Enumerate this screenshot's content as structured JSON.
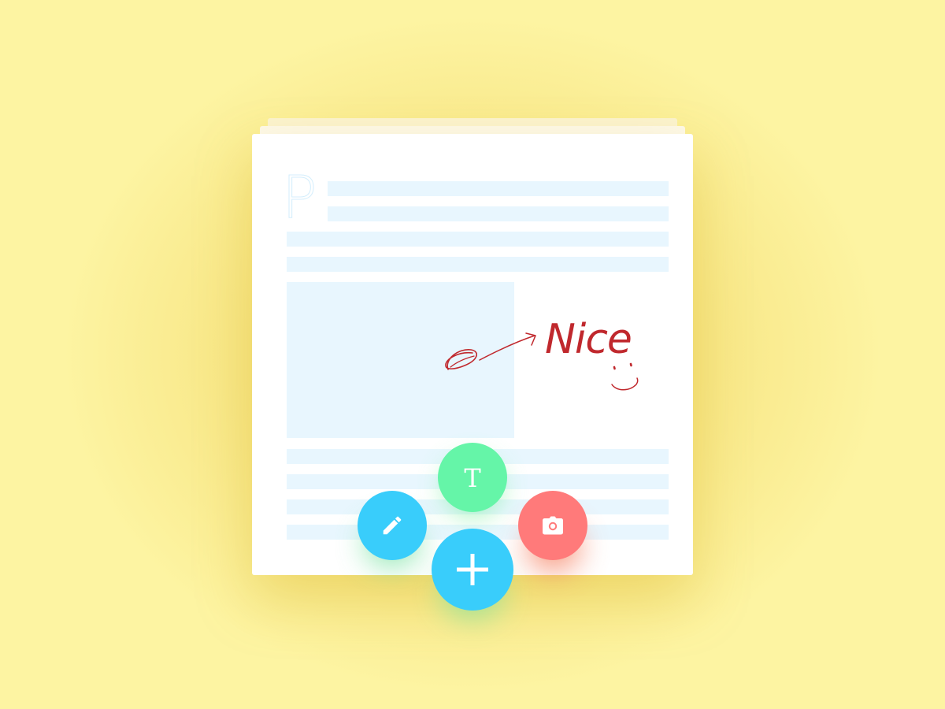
{
  "document": {
    "drop_cap": "P",
    "annotation_text": "Nice",
    "annotation_color": "#c0282d",
    "placeholder_color": "#e8f6fe"
  },
  "actions": [
    {
      "id": "text",
      "icon": "text-icon",
      "glyph": "T",
      "color": "#65f5a8"
    },
    {
      "id": "pen",
      "icon": "pencil-icon",
      "color": "#39cdfb"
    },
    {
      "id": "camera",
      "icon": "camera-icon",
      "color": "#ff7a7a"
    },
    {
      "id": "add",
      "icon": "plus-icon",
      "color": "#39cdfb"
    }
  ],
  "background": {
    "color": "#fdf4a2",
    "glow": "#f3dd6e"
  }
}
